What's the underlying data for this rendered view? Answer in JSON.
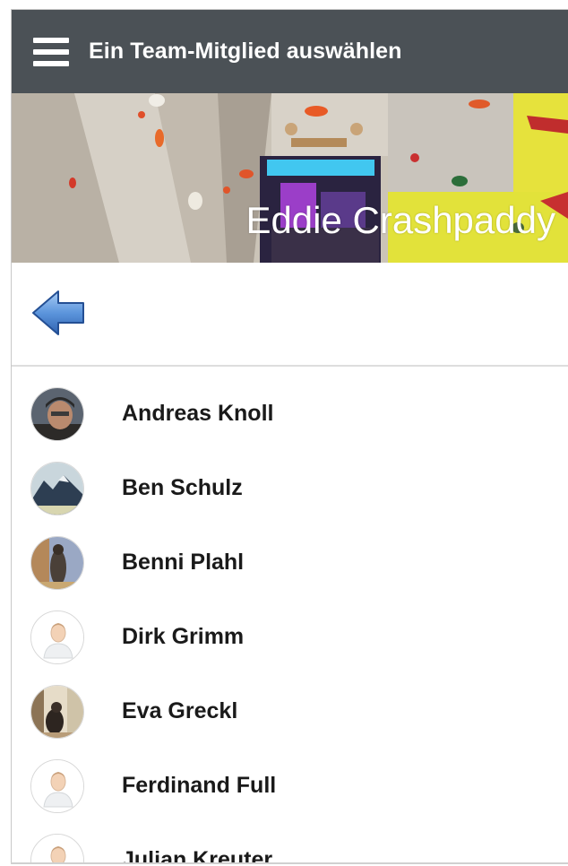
{
  "header": {
    "title": "Ein Team-Mitglied auswählen",
    "menu_icon": "hamburger-menu-icon"
  },
  "hero": {
    "team_name": "Eddie Crashpaddy"
  },
  "toolbar": {
    "back_icon": "back-arrow-icon"
  },
  "members": [
    {
      "name": "Andreas Knoll",
      "avatar": "photo"
    },
    {
      "name": "Ben Schulz",
      "avatar": "photo"
    },
    {
      "name": "Benni Plahl",
      "avatar": "photo"
    },
    {
      "name": "Dirk Grimm",
      "avatar": "default-person"
    },
    {
      "name": "Eva Greckl",
      "avatar": "photo"
    },
    {
      "name": "Ferdinand Full",
      "avatar": "default-person"
    },
    {
      "name": "Julian Kreuter",
      "avatar": "default-person"
    }
  ],
  "colors": {
    "appbar": "#4b5156",
    "back_arrow": "#3e76c2"
  }
}
